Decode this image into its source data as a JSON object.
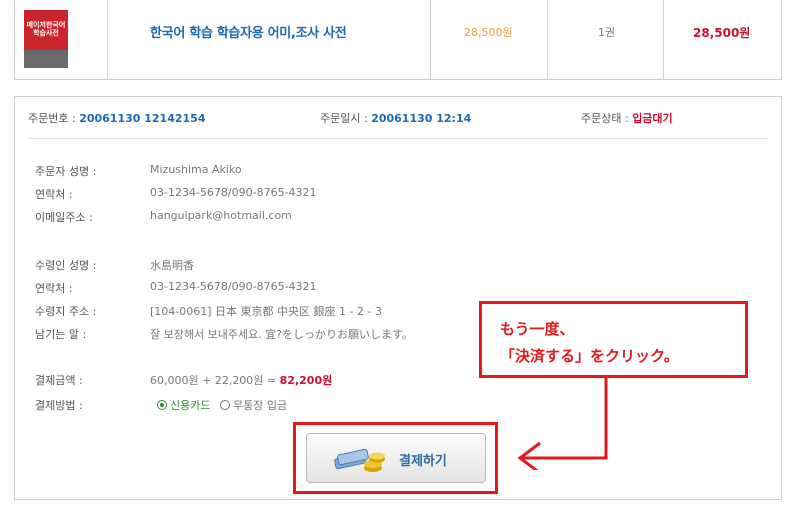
{
  "product": {
    "thumb_text": "메이저한국어 학습사전",
    "name": "한국어 학습 학습자용 어미,조사 사전",
    "price": "28,500원",
    "quantity": "1권",
    "total": "28,500원"
  },
  "order_header": {
    "order_no_label": "주문번호 :",
    "order_no": "20061130 12142154",
    "order_date_label": "주문일시 :",
    "order_date": "20061130 12:14",
    "status_label": "주문상태 :",
    "status": "입금대기"
  },
  "orderer": {
    "name_label": "주문자 성명 :",
    "name": "Mizushima Akiko",
    "contact_label": "연락처 :",
    "contact": "03-1234-5678/090-8765-4321",
    "email_label": "이메일주소 :",
    "email": "hangulpark@hotmail.com"
  },
  "recipient": {
    "name_label": "수령인 성명 :",
    "name": "水島明香",
    "contact_label": "연락처 :",
    "contact": "03-1234-5678/090-8765-4321",
    "address_label": "수령지 주소 :",
    "address": "[104-0061] 日本 東京都 中央区 銀座 1 - 2 - 3",
    "message_label": "남기는 말 :",
    "message": "잘 보장해서 보내주세요. 宜?をしっかりお願いします。"
  },
  "payment": {
    "amount_label": "결제금액 :",
    "amount_formula": "60,000원 + 22,200원 =",
    "amount_total": "82,200원",
    "method_label": "결제방법 :",
    "methods": [
      {
        "label": "신용카드",
        "selected": true
      },
      {
        "label": "무통장 입금",
        "selected": false
      }
    ],
    "button_label": "결제하기"
  },
  "annotation": {
    "line1": "もう一度、",
    "line2": "「決済する」をクリック。"
  },
  "colors": {
    "link_blue": "#1b6ab3",
    "price_orange": "#f09a3a",
    "accent_red": "#c8102e",
    "annotation_red": "#e3191c"
  }
}
